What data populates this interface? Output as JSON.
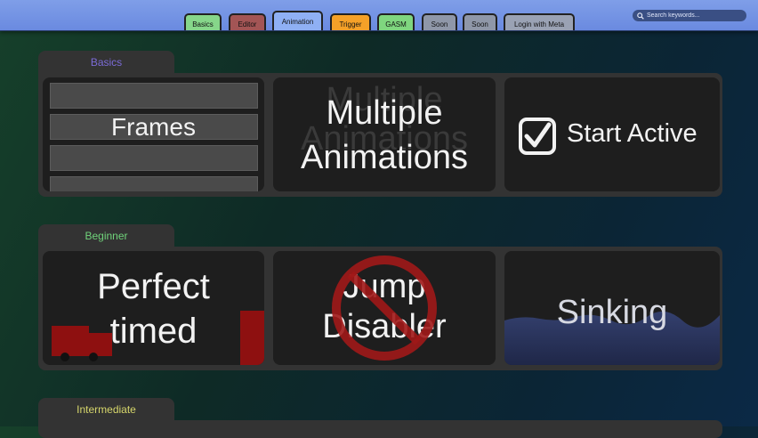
{
  "nav": {
    "tabs": [
      {
        "label": "Basics",
        "color": "#86d68a"
      },
      {
        "label": "Editor",
        "color": "#a35555"
      },
      {
        "label": "Animation",
        "color": "#8fb0f4"
      },
      {
        "label": "Trigger",
        "color": "#f5a128"
      },
      {
        "label": "GASM",
        "color": "#7fd67f"
      },
      {
        "label": "Soon",
        "color": "#8f97a8"
      },
      {
        "label": "Soon",
        "color": "#8f97a8"
      },
      {
        "label": "Login with Meta",
        "color": "#9aa2b4"
      }
    ],
    "active_tab": "Animation",
    "search": {
      "placeholder": "Search keywords...",
      "icon": "search-icon"
    }
  },
  "sections": [
    {
      "title": "Basics",
      "title_color": "#7b6bd6",
      "cards": [
        {
          "label": "Frames"
        },
        {
          "label_line1": "Multiple",
          "label_line2": "Animations"
        },
        {
          "label": "Start Active",
          "icon": "checkbox-checked-icon"
        }
      ]
    },
    {
      "title": "Beginner",
      "title_color": "#6fd27a",
      "cards": [
        {
          "label_line1": "Perfect",
          "label_line2": "timed"
        },
        {
          "label_line1": "Jump",
          "label_line2": "Disabler",
          "icon": "prohibited-icon"
        },
        {
          "label": "Sinking"
        }
      ]
    },
    {
      "title": "Intermediate",
      "title_color": "#d6d66b"
    }
  ]
}
